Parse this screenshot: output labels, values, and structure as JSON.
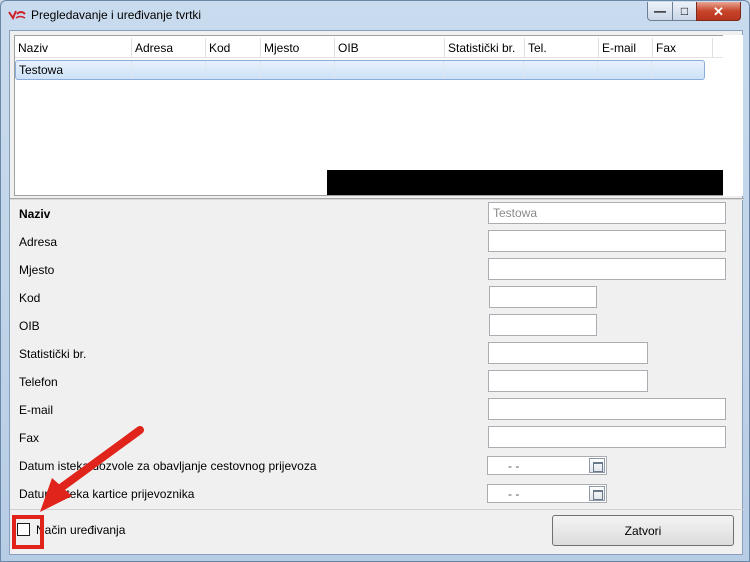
{
  "window": {
    "title": "Pregledavanje i uređivanje tvrtki",
    "buttons": {
      "minimize": "—",
      "maximize": "□",
      "close": "✕"
    }
  },
  "grid": {
    "columns": [
      {
        "key": "naziv",
        "label": "Naziv"
      },
      {
        "key": "adresa",
        "label": "Adresa"
      },
      {
        "key": "kod",
        "label": "Kod"
      },
      {
        "key": "mjesto",
        "label": "Mjesto"
      },
      {
        "key": "oib",
        "label": "OIB"
      },
      {
        "key": "stat",
        "label": "Statistički br."
      },
      {
        "key": "tel",
        "label": "Tel."
      },
      {
        "key": "email",
        "label": "E-mail"
      },
      {
        "key": "fax",
        "label": "Fax"
      }
    ],
    "rows": [
      {
        "naziv": "Testowa",
        "adresa": "",
        "kod": "",
        "mjesto": "",
        "oib": "",
        "stat": "",
        "tel": "",
        "email": "",
        "fax": ""
      }
    ]
  },
  "form": {
    "naziv_label": "Naziv",
    "naziv_value": "Testowa",
    "adresa_label": "Adresa",
    "adresa_value": "",
    "mjesto_label": "Mjesto",
    "mjesto_value": "",
    "kod_label": "Kod",
    "kod_value": "",
    "oib_label": "OIB",
    "oib_value": "",
    "stat_label": "Statistički br.",
    "stat_value": "",
    "telefon_label": "Telefon",
    "telefon_value": "",
    "email_label": "E-mail",
    "email_value": "",
    "fax_label": "Fax",
    "fax_value": "",
    "datum_dozvole_label": "Datum isteka dozvole za obavljanje cestovnog prijevoza",
    "datum_dozvole_value": " -  -",
    "datum_kartice_label": "Datum isteka kartice prijevoznika",
    "datum_kartice_value": " -  -"
  },
  "footer": {
    "edit_mode_label": "Način uređivanja",
    "edit_mode_checked": false,
    "close_button": "Zatvori"
  },
  "colors": {
    "annotation": "#e0231b",
    "selection": "#cde1f7"
  }
}
